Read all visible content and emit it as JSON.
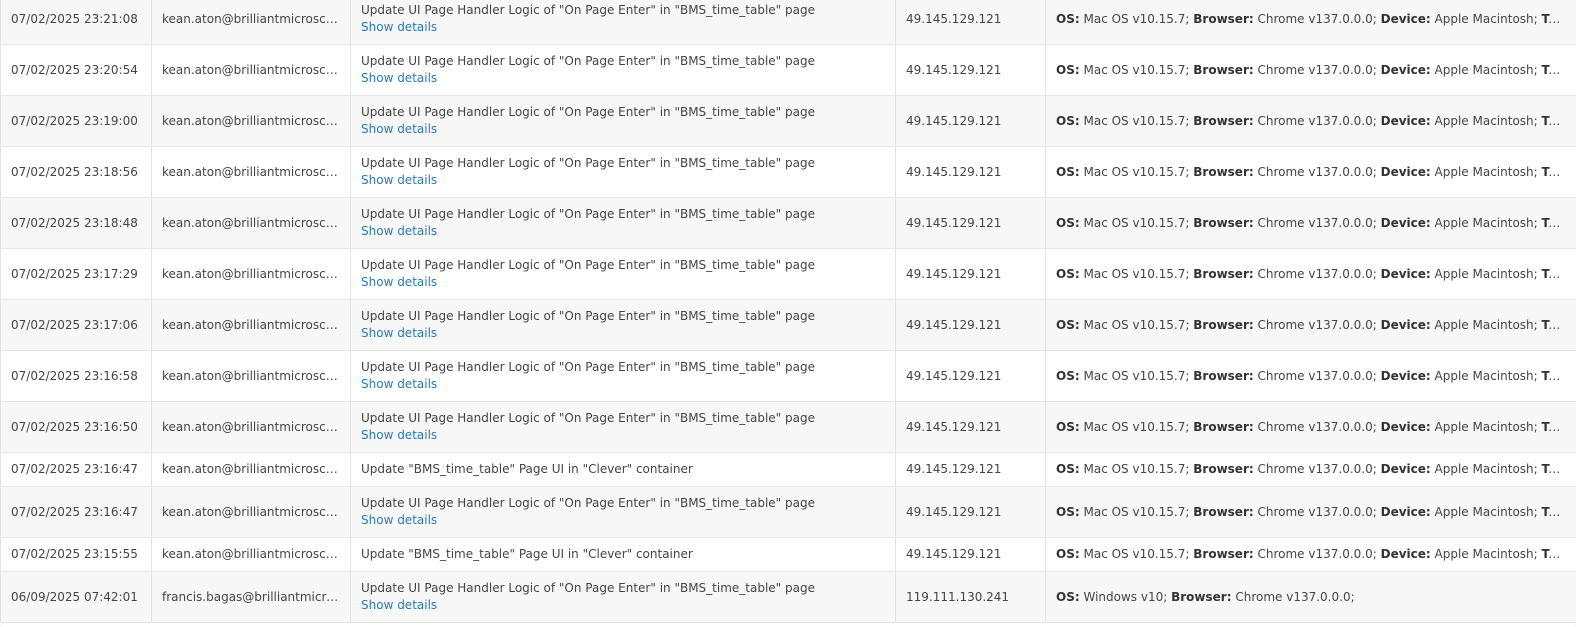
{
  "labels": {
    "os": "OS:",
    "browser": "Browser:",
    "device": "Device:",
    "type": "Type:",
    "show_details": "Show details"
  },
  "colors": {
    "link": "#2a7ab8",
    "row_alt": "#f7f7f7",
    "border": "#e6e6e6"
  },
  "rows": [
    {
      "date": "07/02/2025 23:21:08",
      "user": "kean.aton@brilliantmicroschools.com",
      "action": "Update UI Page Handler Logic of \"On Page Enter\" in \"BMS_time_table\" page",
      "details": true,
      "ip": "49.145.129.121",
      "os": "Mac OS v10.15.7;",
      "browser": "Chrome v137.0.0.0;",
      "device": "Apple Macintosh;"
    },
    {
      "date": "07/02/2025 23:20:54",
      "user": "kean.aton@brilliantmicroschools.com",
      "action": "Update UI Page Handler Logic of \"On Page Enter\" in \"BMS_time_table\" page",
      "details": true,
      "ip": "49.145.129.121",
      "os": "Mac OS v10.15.7;",
      "browser": "Chrome v137.0.0.0;",
      "device": "Apple Macintosh;"
    },
    {
      "date": "07/02/2025 23:19:00",
      "user": "kean.aton@brilliantmicroschools.com",
      "action": "Update UI Page Handler Logic of \"On Page Enter\" in \"BMS_time_table\" page",
      "details": true,
      "ip": "49.145.129.121",
      "os": "Mac OS v10.15.7;",
      "browser": "Chrome v137.0.0.0;",
      "device": "Apple Macintosh;"
    },
    {
      "date": "07/02/2025 23:18:56",
      "user": "kean.aton@brilliantmicroschools.com",
      "action": "Update UI Page Handler Logic of \"On Page Enter\" in \"BMS_time_table\" page",
      "details": true,
      "ip": "49.145.129.121",
      "os": "Mac OS v10.15.7;",
      "browser": "Chrome v137.0.0.0;",
      "device": "Apple Macintosh;"
    },
    {
      "date": "07/02/2025 23:18:48",
      "user": "kean.aton@brilliantmicroschools.com",
      "action": "Update UI Page Handler Logic of \"On Page Enter\" in \"BMS_time_table\" page",
      "details": true,
      "ip": "49.145.129.121",
      "os": "Mac OS v10.15.7;",
      "browser": "Chrome v137.0.0.0;",
      "device": "Apple Macintosh;"
    },
    {
      "date": "07/02/2025 23:17:29",
      "user": "kean.aton@brilliantmicroschools.com",
      "action": "Update UI Page Handler Logic of \"On Page Enter\" in \"BMS_time_table\" page",
      "details": true,
      "ip": "49.145.129.121",
      "os": "Mac OS v10.15.7;",
      "browser": "Chrome v137.0.0.0;",
      "device": "Apple Macintosh;"
    },
    {
      "date": "07/02/2025 23:17:06",
      "user": "kean.aton@brilliantmicroschools.com",
      "action": "Update UI Page Handler Logic of \"On Page Enter\" in \"BMS_time_table\" page",
      "details": true,
      "ip": "49.145.129.121",
      "os": "Mac OS v10.15.7;",
      "browser": "Chrome v137.0.0.0;",
      "device": "Apple Macintosh;"
    },
    {
      "date": "07/02/2025 23:16:58",
      "user": "kean.aton@brilliantmicroschools.com",
      "action": "Update UI Page Handler Logic of \"On Page Enter\" in \"BMS_time_table\" page",
      "details": true,
      "ip": "49.145.129.121",
      "os": "Mac OS v10.15.7;",
      "browser": "Chrome v137.0.0.0;",
      "device": "Apple Macintosh;"
    },
    {
      "date": "07/02/2025 23:16:50",
      "user": "kean.aton@brilliantmicroschools.com",
      "action": "Update UI Page Handler Logic of \"On Page Enter\" in \"BMS_time_table\" page",
      "details": true,
      "ip": "49.145.129.121",
      "os": "Mac OS v10.15.7;",
      "browser": "Chrome v137.0.0.0;",
      "device": "Apple Macintosh;"
    },
    {
      "date": "07/02/2025 23:16:47",
      "user": "kean.aton@brilliantmicroschools.com",
      "action": "Update \"BMS_time_table\" Page UI in \"Clever\" container",
      "details": false,
      "ip": "49.145.129.121",
      "os": "Mac OS v10.15.7;",
      "browser": "Chrome v137.0.0.0;",
      "device": "Apple Macintosh;"
    },
    {
      "date": "07/02/2025 23:16:47",
      "user": "kean.aton@brilliantmicroschools.com",
      "action": "Update UI Page Handler Logic of \"On Page Enter\" in \"BMS_time_table\" page",
      "details": true,
      "ip": "49.145.129.121",
      "os": "Mac OS v10.15.7;",
      "browser": "Chrome v137.0.0.0;",
      "device": "Apple Macintosh;"
    },
    {
      "date": "07/02/2025 23:15:55",
      "user": "kean.aton@brilliantmicroschools.com",
      "action": "Update \"BMS_time_table\" Page UI in \"Clever\" container",
      "details": false,
      "ip": "49.145.129.121",
      "os": "Mac OS v10.15.7;",
      "browser": "Chrome v137.0.0.0;",
      "device": "Apple Macintosh;"
    },
    {
      "date": "06/09/2025 07:42:01",
      "user": "francis.bagas@brilliantmicroschools.com",
      "action": "Update UI Page Handler Logic of \"On Page Enter\" in \"BMS_time_table\" page",
      "details": true,
      "ip": "119.111.130.241",
      "os": "Windows v10;",
      "browser": "Chrome v137.0.0.0;",
      "device": ""
    }
  ]
}
